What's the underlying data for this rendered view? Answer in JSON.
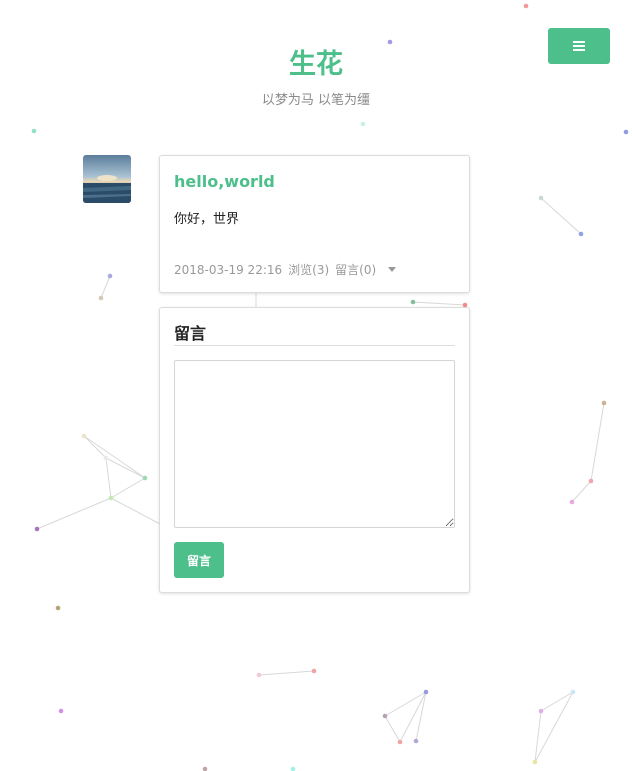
{
  "site": {
    "title": "生花",
    "subtitle": "以梦为马 以笔为缰"
  },
  "header": {
    "menu_icon": "hamburger-menu-icon",
    "accent_color": "#4cbf8b"
  },
  "post": {
    "avatar_icon": "ocean-sunset-avatar",
    "title": "hello,world",
    "body": "你好，世界",
    "date": "2018-03-19 22:16",
    "views": "浏览(3)",
    "comments": "留言(0)",
    "expand_icon": "caret-down-icon"
  },
  "comment_form": {
    "heading": "留言",
    "textarea_placeholder": "",
    "submit_label": "留言"
  }
}
